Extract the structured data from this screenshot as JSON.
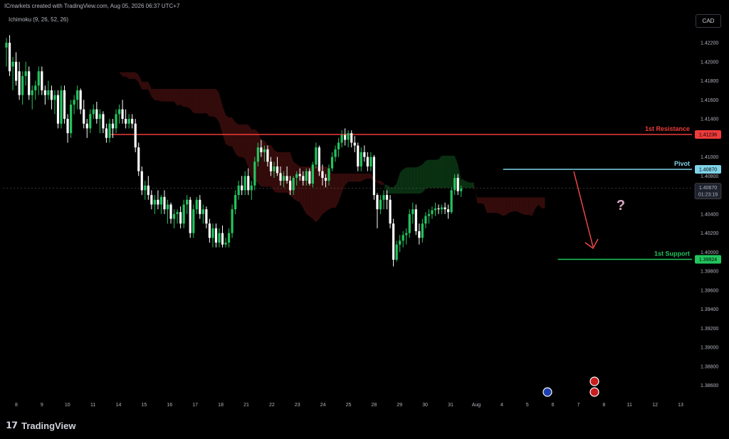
{
  "header": {
    "attribution": "ICmarkets created with TradingView.com, Aug 05, 2026 06:37 UTC+7",
    "indicator": "Ichimoku (9, 26, 52, 26)",
    "currency": "CAD"
  },
  "brand": {
    "name": "TradingView"
  },
  "colors": {
    "background": "#000000",
    "bull": "#22c55e",
    "bear": "#ffffff",
    "resistance": "#ef3b3b",
    "pivot": "#7fd3e8",
    "support": "#22c55e",
    "cloud_bear": "#3a0c0c",
    "cloud_bull": "#0b3514",
    "arrow": "#ff4a4a"
  },
  "chart_data": {
    "type": "candlestick",
    "ylim": [
      1.385,
      1.4235
    ],
    "y_ticks": [
      "1.42200",
      "1.42000",
      "1.41800",
      "1.41600",
      "1.41400",
      "1.41000",
      "1.40800",
      "1.40400",
      "1.40200",
      "1.40000",
      "1.39800",
      "1.39600",
      "1.39400",
      "1.39200",
      "1.39000",
      "1.38800",
      "1.38600"
    ],
    "x_ticks": [
      "8",
      "9",
      "10",
      "11",
      "14",
      "15",
      "16",
      "17",
      "18",
      "21",
      "22",
      "23",
      "24",
      "25",
      "28",
      "29",
      "30",
      "31",
      "Aug",
      "4",
      "5",
      "6",
      "7",
      "8",
      "11",
      "12",
      "13"
    ],
    "levels": [
      {
        "name": "1st Resistance",
        "value": 1.41236,
        "label": "1.41236",
        "color": "#ef3b3b",
        "start": 32
      },
      {
        "name": "Pivot",
        "value": 1.4087,
        "label": "1.40870",
        "color": "#7fd3e8",
        "start": 154
      },
      {
        "name": "1st Support",
        "value": 1.39924,
        "label": "1.39924",
        "color": "#22c55e",
        "start": 171
      }
    ],
    "current_price": {
      "value": 1.4067,
      "label": "1.40670",
      "countdown": "01:23:19"
    },
    "candles": [
      [
        1.4215,
        1.4225,
        1.4195,
        1.422
      ],
      [
        1.422,
        1.4228,
        1.4185,
        1.419
      ],
      [
        1.4195,
        1.4205,
        1.417,
        1.42
      ],
      [
        1.42,
        1.421,
        1.4175,
        1.418
      ],
      [
        1.419,
        1.42,
        1.416,
        1.4165
      ],
      [
        1.4165,
        1.419,
        1.4155,
        1.4185
      ],
      [
        1.4185,
        1.42,
        1.4175,
        1.419
      ],
      [
        1.419,
        1.4195,
        1.416,
        1.4165
      ],
      [
        1.4165,
        1.4175,
        1.415,
        1.417
      ],
      [
        1.417,
        1.418,
        1.416,
        1.4175
      ],
      [
        1.4175,
        1.4195,
        1.4165,
        1.419
      ],
      [
        1.419,
        1.4195,
        1.4165,
        1.417
      ],
      [
        1.417,
        1.4175,
        1.4155,
        1.4165
      ],
      [
        1.4165,
        1.418,
        1.416,
        1.417
      ],
      [
        1.417,
        1.4175,
        1.415,
        1.416
      ],
      [
        1.416,
        1.417,
        1.4145,
        1.4165
      ],
      [
        1.4165,
        1.417,
        1.413,
        1.4135
      ],
      [
        1.4135,
        1.4175,
        1.413,
        1.417
      ],
      [
        1.417,
        1.4175,
        1.4135,
        1.414
      ],
      [
        1.414,
        1.4145,
        1.4115,
        1.4125
      ],
      [
        1.4125,
        1.416,
        1.412,
        1.4155
      ],
      [
        1.4155,
        1.4165,
        1.4145,
        1.416
      ],
      [
        1.416,
        1.4175,
        1.415,
        1.417
      ],
      [
        1.417,
        1.4172,
        1.4145,
        1.415
      ],
      [
        1.415,
        1.416,
        1.413,
        1.4135
      ],
      [
        1.4135,
        1.414,
        1.412,
        1.413
      ],
      [
        1.413,
        1.415,
        1.4125,
        1.4145
      ],
      [
        1.4145,
        1.4155,
        1.414,
        1.415
      ],
      [
        1.415,
        1.4158,
        1.4135,
        1.414
      ],
      [
        1.414,
        1.415,
        1.4125,
        1.4145
      ],
      [
        1.4145,
        1.4148,
        1.4125,
        1.413
      ],
      [
        1.413,
        1.4135,
        1.4115,
        1.412
      ],
      [
        1.412,
        1.414,
        1.4115,
        1.4135
      ],
      [
        1.4135,
        1.414,
        1.412,
        1.413
      ],
      [
        1.413,
        1.415,
        1.4125,
        1.4145
      ],
      [
        1.4145,
        1.4155,
        1.4135,
        1.415
      ],
      [
        1.415,
        1.416,
        1.4135,
        1.414
      ],
      [
        1.414,
        1.415,
        1.413,
        1.4135
      ],
      [
        1.4135,
        1.4145,
        1.413,
        1.414
      ],
      [
        1.414,
        1.4145,
        1.413,
        1.4135
      ],
      [
        1.4135,
        1.414,
        1.4105,
        1.411
      ],
      [
        1.411,
        1.4115,
        1.408,
        1.4085
      ],
      [
        1.4085,
        1.409,
        1.406,
        1.4065
      ],
      [
        1.4065,
        1.4075,
        1.4055,
        1.407
      ],
      [
        1.407,
        1.408,
        1.4055,
        1.406
      ],
      [
        1.406,
        1.4065,
        1.4045,
        1.405
      ],
      [
        1.405,
        1.406,
        1.404,
        1.4055
      ],
      [
        1.4055,
        1.4065,
        1.4045,
        1.405
      ],
      [
        1.405,
        1.406,
        1.404,
        1.4058
      ],
      [
        1.4058,
        1.4065,
        1.404,
        1.4045
      ],
      [
        1.4045,
        1.4055,
        1.403,
        1.405
      ],
      [
        1.405,
        1.4052,
        1.403,
        1.4035
      ],
      [
        1.4035,
        1.4045,
        1.4025,
        1.404
      ],
      [
        1.404,
        1.4045,
        1.403,
        1.4042
      ],
      [
        1.4042,
        1.4048,
        1.4025,
        1.403
      ],
      [
        1.403,
        1.4055,
        1.4025,
        1.405
      ],
      [
        1.405,
        1.406,
        1.404,
        1.4055
      ],
      [
        1.4055,
        1.4058,
        1.4015,
        1.402
      ],
      [
        1.402,
        1.405,
        1.4015,
        1.4045
      ],
      [
        1.4045,
        1.4058,
        1.404,
        1.4055
      ],
      [
        1.4055,
        1.406,
        1.4035,
        1.404
      ],
      [
        1.404,
        1.405,
        1.403,
        1.4045
      ],
      [
        1.4045,
        1.4048,
        1.4025,
        1.403
      ],
      [
        1.403,
        1.4035,
        1.401,
        1.4015
      ],
      [
        1.4015,
        1.403,
        1.4005,
        1.4025
      ],
      [
        1.4025,
        1.403,
        1.4005,
        1.401
      ],
      [
        1.401,
        1.4025,
        1.4005,
        1.402
      ],
      [
        1.402,
        1.4028,
        1.4005,
        1.4008
      ],
      [
        1.4008,
        1.4015,
        1.4005,
        1.401
      ],
      [
        1.401,
        1.4025,
        1.4005,
        1.402
      ],
      [
        1.402,
        1.405,
        1.4015,
        1.4045
      ],
      [
        1.4045,
        1.4065,
        1.404,
        1.406
      ],
      [
        1.406,
        1.4075,
        1.4055,
        1.407
      ],
      [
        1.407,
        1.408,
        1.406,
        1.4065
      ],
      [
        1.4065,
        1.4085,
        1.406,
        1.408
      ],
      [
        1.408,
        1.4088,
        1.406,
        1.4065
      ],
      [
        1.4065,
        1.4075,
        1.4055,
        1.407
      ],
      [
        1.407,
        1.41,
        1.4065,
        1.4095
      ],
      [
        1.4095,
        1.4115,
        1.409,
        1.411
      ],
      [
        1.411,
        1.4118,
        1.41,
        1.4105
      ],
      [
        1.4105,
        1.4112,
        1.4095,
        1.4108
      ],
      [
        1.4108,
        1.4112,
        1.409,
        1.4095
      ],
      [
        1.4095,
        1.41,
        1.408,
        1.4085
      ],
      [
        1.4085,
        1.4095,
        1.4078,
        1.409
      ],
      [
        1.409,
        1.41,
        1.408,
        1.4083
      ],
      [
        1.4083,
        1.409,
        1.407,
        1.4075
      ],
      [
        1.4075,
        1.4085,
        1.4068,
        1.408
      ],
      [
        1.408,
        1.409,
        1.4072,
        1.4075
      ],
      [
        1.4075,
        1.408,
        1.406,
        1.4065
      ],
      [
        1.4065,
        1.408,
        1.406,
        1.4078
      ],
      [
        1.4078,
        1.4085,
        1.407,
        1.4082
      ],
      [
        1.4082,
        1.4088,
        1.4075,
        1.408
      ],
      [
        1.408,
        1.4085,
        1.407,
        1.4075
      ],
      [
        1.4075,
        1.4088,
        1.407,
        1.4085
      ],
      [
        1.4085,
        1.4088,
        1.407,
        1.4072
      ],
      [
        1.4072,
        1.4095,
        1.4068,
        1.4092
      ],
      [
        1.4092,
        1.4115,
        1.4088,
        1.411
      ],
      [
        1.411,
        1.4112,
        1.408,
        1.4085
      ],
      [
        1.4085,
        1.4092,
        1.407,
        1.4078
      ],
      [
        1.4078,
        1.4082,
        1.4068,
        1.4075
      ],
      [
        1.4075,
        1.4092,
        1.407,
        1.4088
      ],
      [
        1.4088,
        1.4105,
        1.4085,
        1.41
      ],
      [
        1.41,
        1.4112,
        1.4095,
        1.4108
      ],
      [
        1.4108,
        1.412,
        1.41,
        1.4115
      ],
      [
        1.4115,
        1.4128,
        1.411,
        1.4123
      ],
      [
        1.4123,
        1.413,
        1.4112,
        1.4118
      ],
      [
        1.4118,
        1.4128,
        1.411,
        1.4125
      ],
      [
        1.4125,
        1.4128,
        1.411,
        1.4115
      ],
      [
        1.4115,
        1.4122,
        1.4105,
        1.4112
      ],
      [
        1.4112,
        1.4115,
        1.4085,
        1.409
      ],
      [
        1.409,
        1.411,
        1.4085,
        1.4105
      ],
      [
        1.4105,
        1.4112,
        1.4095,
        1.41
      ],
      [
        1.41,
        1.4105,
        1.4085,
        1.409
      ],
      [
        1.409,
        1.4105,
        1.4085,
        1.41
      ],
      [
        1.41,
        1.4102,
        1.4055,
        1.406
      ],
      [
        1.406,
        1.4062,
        1.4025,
        1.4045
      ],
      [
        1.4045,
        1.406,
        1.404,
        1.4055
      ],
      [
        1.4055,
        1.4065,
        1.4045,
        1.406
      ],
      [
        1.406,
        1.4065,
        1.4045,
        1.4055
      ],
      [
        1.4055,
        1.406,
        1.4025,
        1.403
      ],
      [
        1.403,
        1.4035,
        1.3985,
        1.3992
      ],
      [
        1.3992,
        1.4012,
        1.399,
        1.4008
      ],
      [
        1.4008,
        1.4018,
        1.4,
        1.4012
      ],
      [
        1.4012,
        1.4022,
        1.4005,
        1.4018
      ],
      [
        1.4018,
        1.4025,
        1.4008,
        1.402
      ],
      [
        1.402,
        1.4045,
        1.4015,
        1.404
      ],
      [
        1.404,
        1.4052,
        1.403,
        1.4045
      ],
      [
        1.4045,
        1.405,
        1.4018,
        1.4022
      ],
      [
        1.4022,
        1.403,
        1.4008,
        1.4015
      ],
      [
        1.4015,
        1.4035,
        1.401,
        1.403
      ],
      [
        1.403,
        1.4042,
        1.4025,
        1.4038
      ],
      [
        1.4038,
        1.4045,
        1.403,
        1.404
      ],
      [
        1.404,
        1.4048,
        1.4035,
        1.4044
      ],
      [
        1.4044,
        1.4052,
        1.4038,
        1.4046
      ],
      [
        1.4046,
        1.405,
        1.404,
        1.4045
      ],
      [
        1.4045,
        1.405,
        1.404,
        1.4047
      ],
      [
        1.4047,
        1.4052,
        1.404,
        1.4045
      ],
      [
        1.4045,
        1.405,
        1.4035,
        1.4042
      ],
      [
        1.4042,
        1.4068,
        1.404,
        1.4065
      ],
      [
        1.4065,
        1.4082,
        1.406,
        1.4078
      ],
      [
        1.4078,
        1.4082,
        1.406,
        1.4064
      ],
      [
        1.4064,
        1.407,
        1.4058,
        1.4067
      ]
    ]
  }
}
